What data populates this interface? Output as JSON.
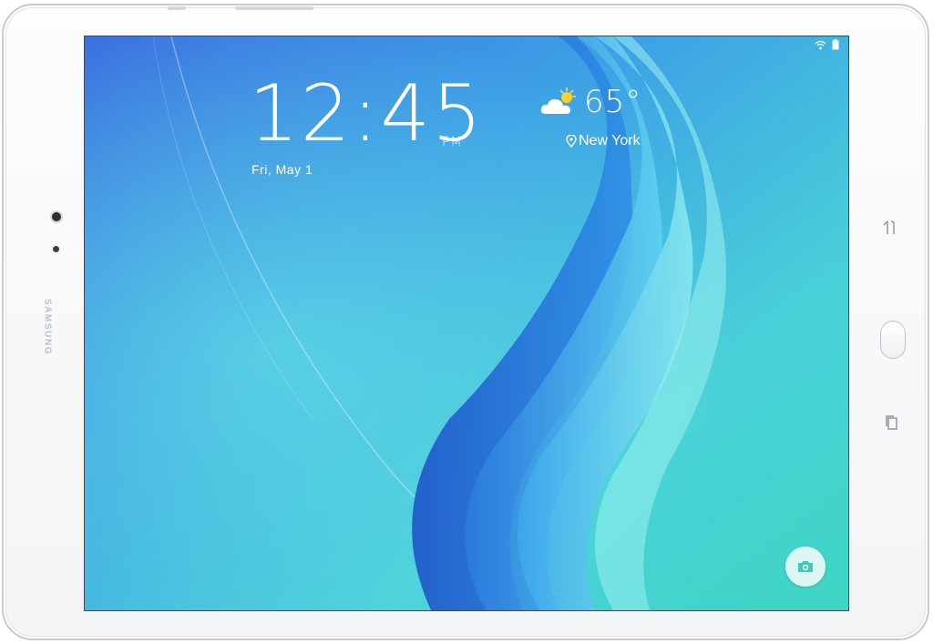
{
  "device": {
    "brand": "SAMSUNG",
    "colors": {
      "bezel": "#f7f8f9",
      "accent": "#3f8fe0"
    }
  },
  "lockscreen": {
    "time": "12:45",
    "ampm": "PM",
    "date": "Fri, May 1",
    "weather": {
      "icon": "partly-cloudy-icon",
      "temperature": "65°"
    },
    "location": {
      "icon": "location-pin-icon",
      "name": "New York"
    },
    "camera_shortcut_icon": "camera-icon"
  },
  "status_bar": {
    "icons": [
      "wifi-icon",
      "battery-icon"
    ]
  },
  "hardware_keys": [
    "recent-apps-icon",
    "home-button",
    "back-icon"
  ]
}
